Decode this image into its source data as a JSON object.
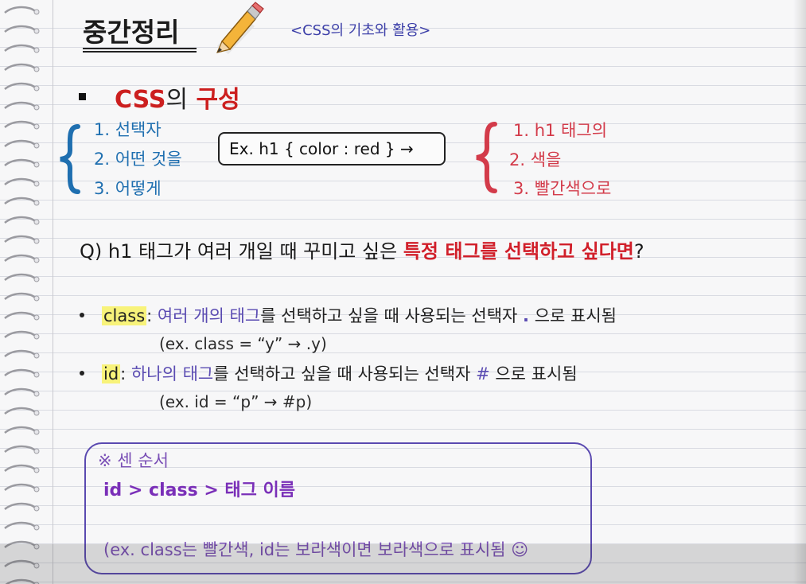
{
  "title": "중간정리",
  "subtitle": "<CSS의 기초와 활용>",
  "section": {
    "css": "CSS",
    "ui": "의",
    "structure": "구성"
  },
  "left_list": [
    "1. 선택자",
    "2. 어떤 것을",
    "3. 어떻게"
  ],
  "example_box": "Ex. h1 { color : red } →",
  "right_list": [
    "1. h1 태그의",
    "2. 색을",
    "3. 빨간색으로"
  ],
  "question": {
    "prefix": "Q) h1 태그가 여러 개일 때 꾸미고 싶은 ",
    "highlight": "특정 태그를 선택하고 싶다면",
    "suffix": "?"
  },
  "class_item": {
    "keyword": "class",
    "colon": ": ",
    "purple": "여러 개의 태그",
    "rest": "를 선택하고 싶을 때 사용되는 선택자 ",
    "symbol": ".",
    "tail": " 으로 표시됨",
    "example": "(ex.   class = “y” → .y)"
  },
  "id_item": {
    "keyword": "id",
    "colon": ": ",
    "purple": "하나의 태그",
    "rest": "를 선택하고 싶을 때 사용되는 선택자 ",
    "symbol": "#",
    "tail": " 으로 표시됨",
    "example": "(ex.   id = “p” → #p)"
  },
  "note": {
    "title": "※ 센 순서",
    "order": "id > class > 태그 이름",
    "example": "(ex. class는 빨간색, id는 보라색이면 보라색으로 표시됨 ☺"
  },
  "colors": {
    "blue": "#1f6fb0",
    "red": "#cc1f1f",
    "purple": "#5a4bb2",
    "highlight": "#f8f37a"
  },
  "icons": [
    "pencil-icon",
    "spiral-ring-icon",
    "left-brace-icon",
    "right-brace-icon"
  ]
}
